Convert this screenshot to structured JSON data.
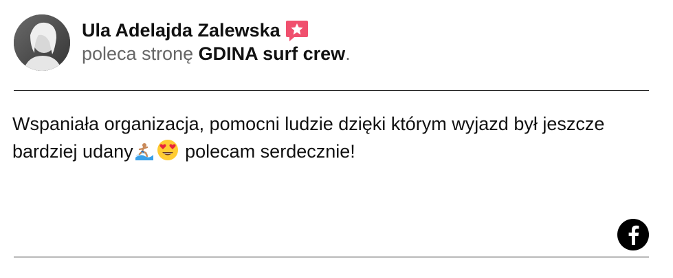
{
  "reviewer": {
    "name": "Ula Adelajda Zalewska",
    "action": "poleca stronę",
    "page_name": "GDINA surf crew",
    "punctuation": "."
  },
  "review": {
    "text_before_emoji": "Wspaniała organizacja, pomocni ludzie dzięki którym wyjazd był jeszcze bardziej udany",
    "text_after_emoji": " polecam serdecznie!",
    "emojis": [
      "surfer-emoji",
      "heart-eyes-emoji"
    ]
  },
  "icons": {
    "recommend_badge": "recommend-star-icon",
    "social": "facebook-icon"
  },
  "colors": {
    "badge": "#f0506e",
    "text": "#111111",
    "muted": "#666666",
    "facebook_circle": "#000000"
  }
}
